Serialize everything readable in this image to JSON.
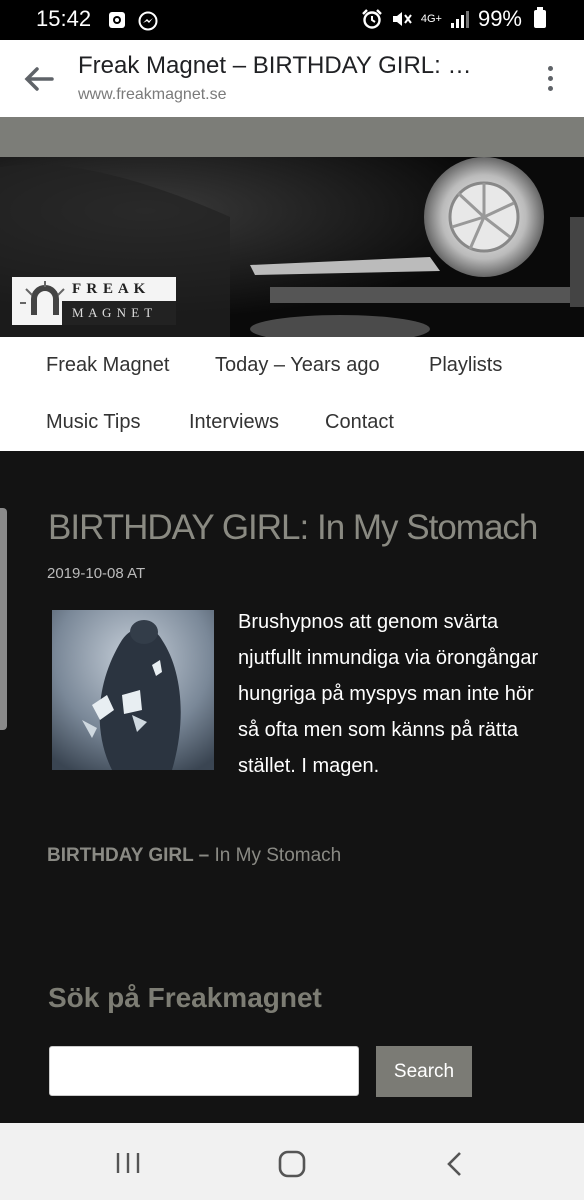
{
  "status_bar": {
    "time": "15:42",
    "network": "4G+",
    "battery": "99%"
  },
  "toolbar": {
    "title": "Freak Magnet – BIRTHDAY GIRL: In My Stomach",
    "url": "www.freakmagnet.se"
  },
  "logo": {
    "line1": "F R E A K",
    "line2": "M A G N E T"
  },
  "nav": {
    "items": [
      "Freak Magnet",
      "Today – Years ago",
      "Playlists",
      "Music Tips",
      "Interviews",
      "Contact"
    ]
  },
  "post": {
    "title": "BIRTHDAY GIRL: In My Stomach",
    "date": "2019-10-08 AT",
    "body": "Brushypnos att genom svärta njutfullt inmundiga via örongångar hungriga på myspys man inte hör så ofta men som känns på rätta stället. I magen.",
    "artist": "BIRTHDAY GIRL –",
    "track": "In My Stomach"
  },
  "search": {
    "heading": "Sök på Freakmagnet",
    "placeholder": "",
    "button": "Search"
  },
  "icons": {
    "back": "back-arrow-icon",
    "menu": "more-vert-icon",
    "recents": "recents-icon",
    "home": "home-icon",
    "nav_back": "nav-back-icon"
  }
}
